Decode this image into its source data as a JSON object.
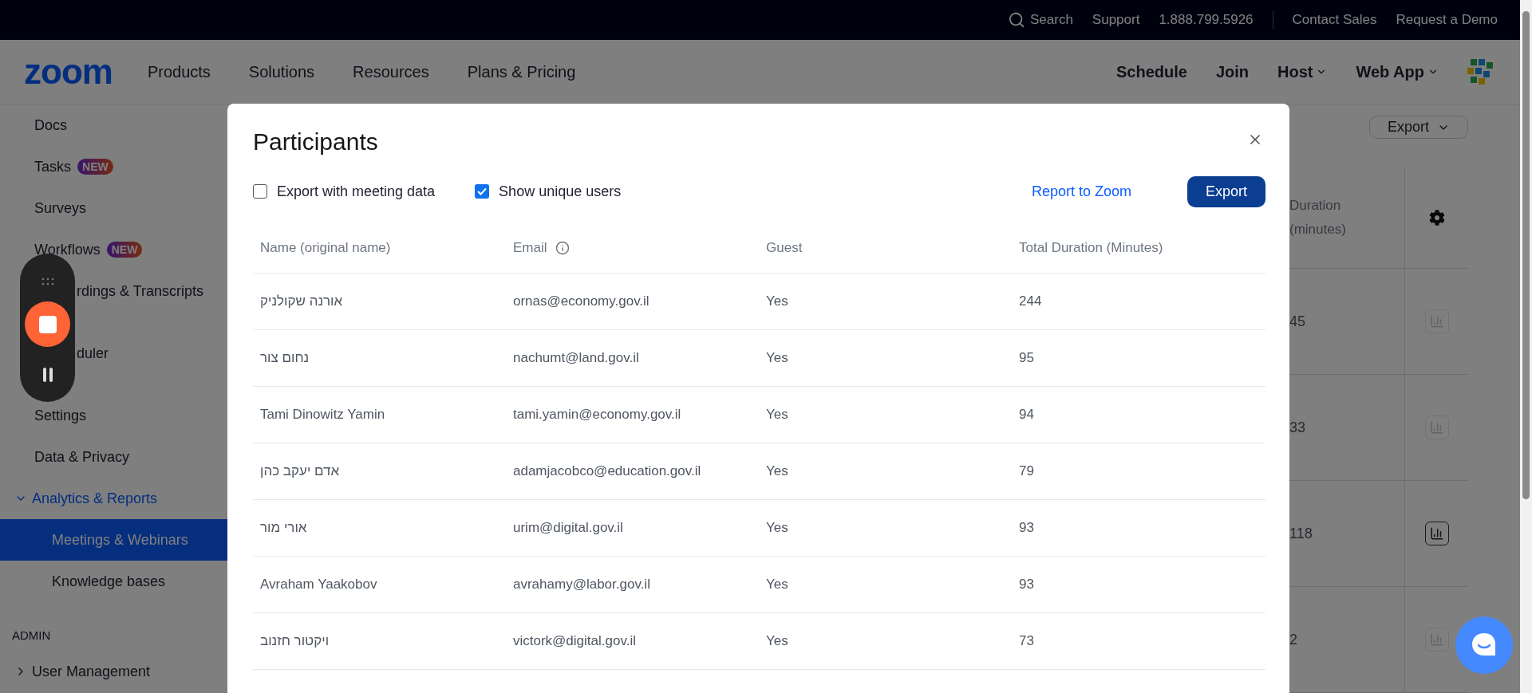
{
  "top_bar": {
    "search": "Search",
    "links": [
      "Support",
      "1.888.799.5926"
    ],
    "right_links": [
      "Contact Sales",
      "Request a Demo"
    ]
  },
  "nav": {
    "logo": "zoom",
    "items": [
      "Products",
      "Solutions",
      "Resources",
      "Plans & Pricing"
    ],
    "right_items": [
      {
        "label": "Schedule",
        "dropdown": false
      },
      {
        "label": "Join",
        "dropdown": false
      },
      {
        "label": "Host",
        "dropdown": true
      },
      {
        "label": "Web App",
        "dropdown": true
      }
    ]
  },
  "sidebar": {
    "items": [
      {
        "label": "Docs",
        "kind": "link",
        "selected": false
      },
      {
        "label": "Tasks",
        "kind": "link",
        "badge": "NEW",
        "selected": false
      },
      {
        "label": "Surveys",
        "kind": "link",
        "selected": false
      },
      {
        "label": "Workflows",
        "kind": "link",
        "badge": "NEW",
        "selected": false
      },
      {
        "label": "rdings & Transcripts",
        "kind": "covered",
        "selected": false
      },
      {
        "label": "duler",
        "kind": "covered",
        "selected": false
      },
      {
        "label": "Settings",
        "kind": "link",
        "selected": false
      },
      {
        "label": "Data & Privacy",
        "kind": "link",
        "selected": false
      },
      {
        "label": "Analytics & Reports",
        "kind": "group",
        "expanded": true,
        "children": [
          {
            "label": "Meetings & Webinars",
            "selected": true
          },
          {
            "label": "Knowledge bases",
            "selected": false
          }
        ]
      }
    ],
    "section": "ADMIN",
    "admin_items": [
      {
        "label": "User Management",
        "expanded": false,
        "selected": false
      }
    ]
  },
  "report": {
    "export_button": "Export",
    "column": "Duration (minutes)",
    "rows": [
      {
        "duration": "45",
        "chart_enabled": false
      },
      {
        "duration": "33",
        "chart_enabled": false
      },
      {
        "duration": "118",
        "chart_enabled": true
      },
      {
        "duration": "2",
        "chart_enabled": false
      }
    ]
  },
  "modal": {
    "title": "Participants",
    "options": [
      {
        "label": "Export with meeting data",
        "checked": false
      },
      {
        "label": "Show unique users",
        "checked": true
      }
    ],
    "report_link": "Report to Zoom",
    "export_button": "Export",
    "columns": [
      {
        "label": "Name (original name)",
        "info": false
      },
      {
        "label": "Email",
        "info": true
      },
      {
        "label": "Guest",
        "info": false
      },
      {
        "label": "Total Duration (Minutes)",
        "info": false
      }
    ],
    "rows": [
      {
        "name": "אורנה שקולניק",
        "email": "ornas@economy.gov.il",
        "guest": "Yes",
        "duration": "244"
      },
      {
        "name": "נחום צור",
        "email": "nachumt@land.gov.il",
        "guest": "Yes",
        "duration": "95"
      },
      {
        "name": "Tami Dinowitz Yamin",
        "email": "tami.yamin@economy.gov.il",
        "guest": "Yes",
        "duration": "94"
      },
      {
        "name": "אדם יעקב כהן",
        "email": "adamjacobco@education.gov.il",
        "guest": "Yes",
        "duration": "79"
      },
      {
        "name": "אורי מור",
        "email": "urim@digital.gov.il",
        "guest": "Yes",
        "duration": "93"
      },
      {
        "name": "Avraham Yaakobov",
        "email": "avrahamy@labor.gov.il",
        "guest": "Yes",
        "duration": "93"
      },
      {
        "name": "ויקטור חזנוב",
        "email": "victork@digital.gov.il",
        "guest": "Yes",
        "duration": "73"
      }
    ]
  }
}
